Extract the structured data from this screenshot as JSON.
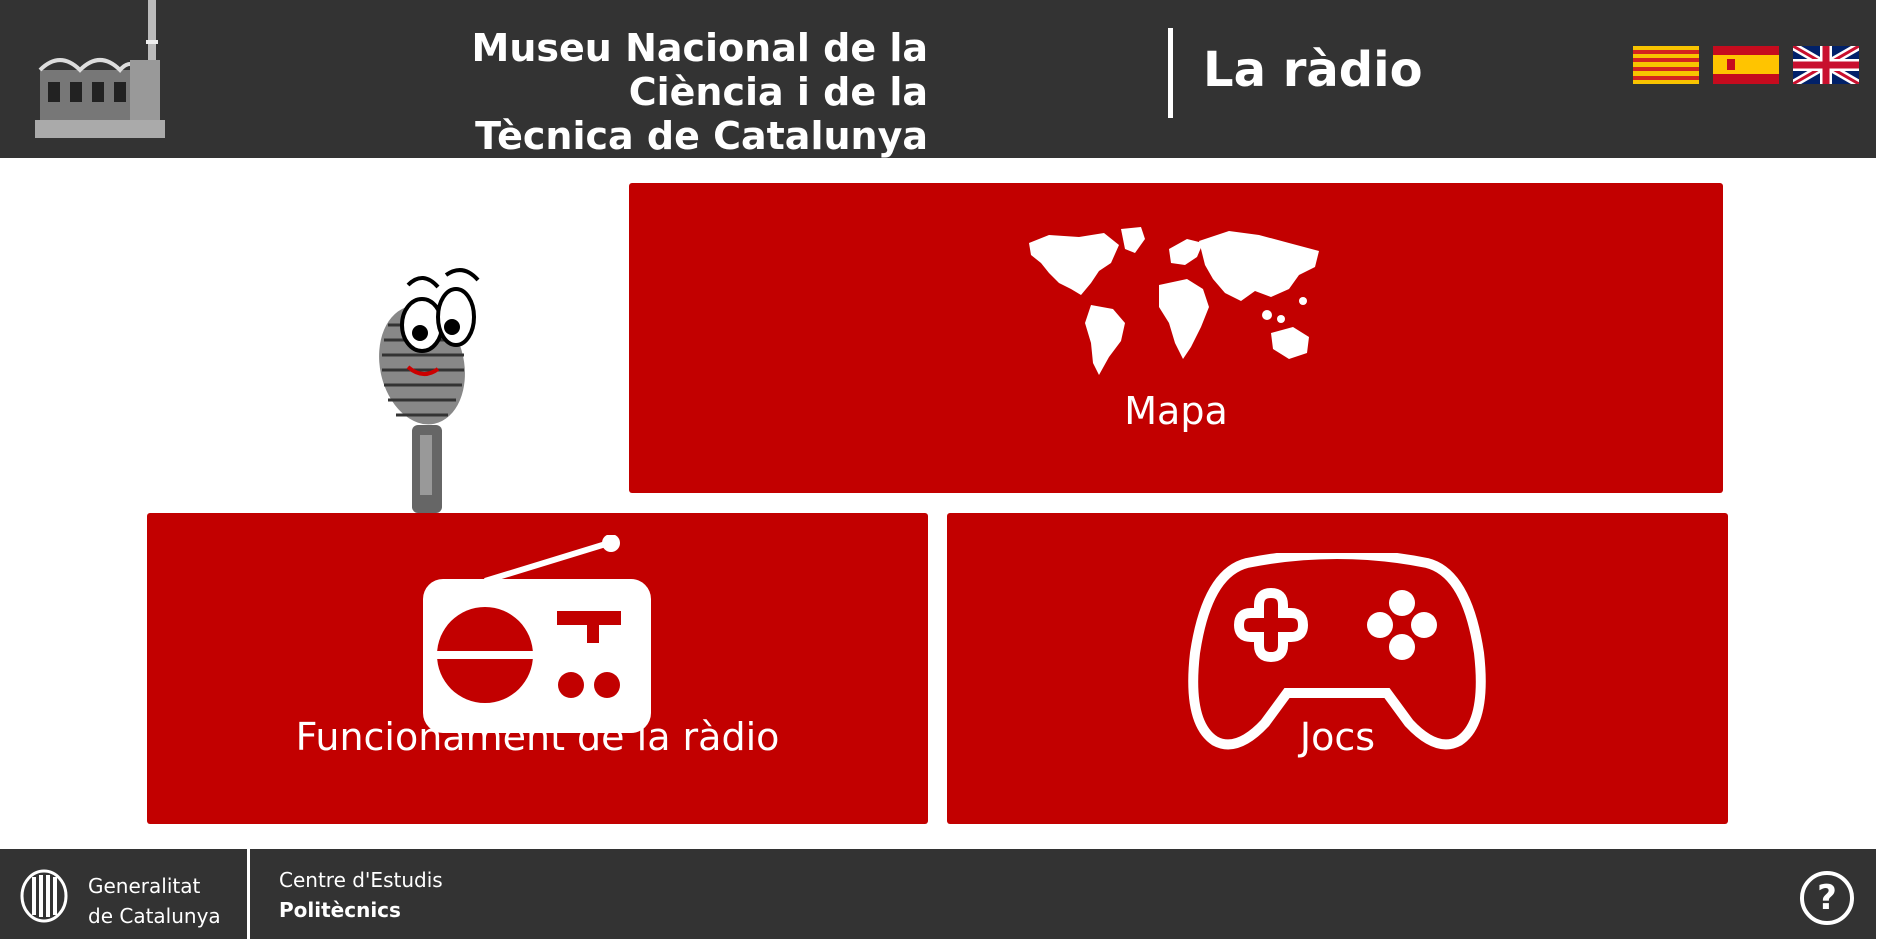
{
  "header": {
    "museum_line1": "Museu Nacional de la Ciència i de la",
    "museum_line2": "Tècnica de Catalunya",
    "section_title": "La ràdio",
    "languages": [
      "catalan-flag-icon",
      "spanish-flag-icon",
      "uk-flag-icon"
    ]
  },
  "tiles": {
    "map_label": "Mapa",
    "radio_label": "Funcionament de la ràdio",
    "games_label": "Jocs"
  },
  "footer": {
    "gen_line1": "Generalitat",
    "gen_line2": "de Catalunya",
    "cep_line1": "Centre d'Estudis",
    "cep_line2": "Politècnics",
    "help_label": "?"
  },
  "colors": {
    "header_bg": "#333333",
    "tile_red": "#c20000",
    "white": "#ffffff"
  }
}
